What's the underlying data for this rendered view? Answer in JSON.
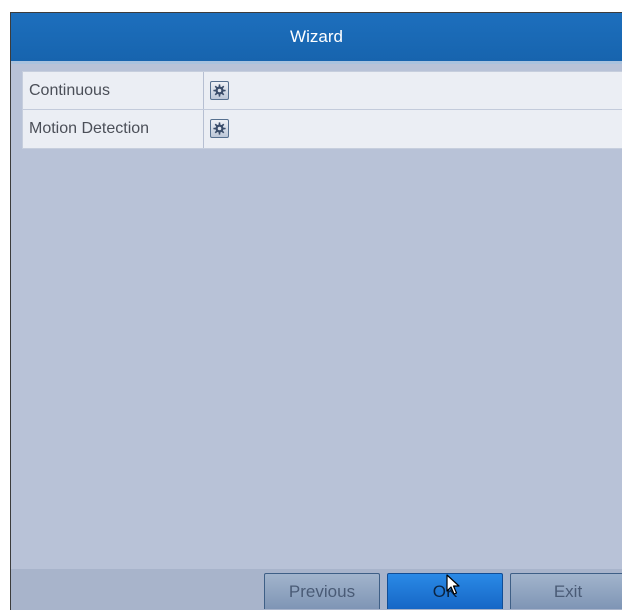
{
  "window": {
    "title": "Wizard"
  },
  "record_modes": [
    {
      "label": "Continuous",
      "action_icon": "gear-icon"
    },
    {
      "label": "Motion Detection",
      "action_icon": "gear-icon"
    }
  ],
  "footer": {
    "previous_label": "Previous",
    "ok_label": "OK",
    "exit_label": "Exit"
  },
  "colors": {
    "title_bar": "#1764ae",
    "panel_background": "#b8c2d7",
    "ok_button": "#1f7ad6"
  }
}
